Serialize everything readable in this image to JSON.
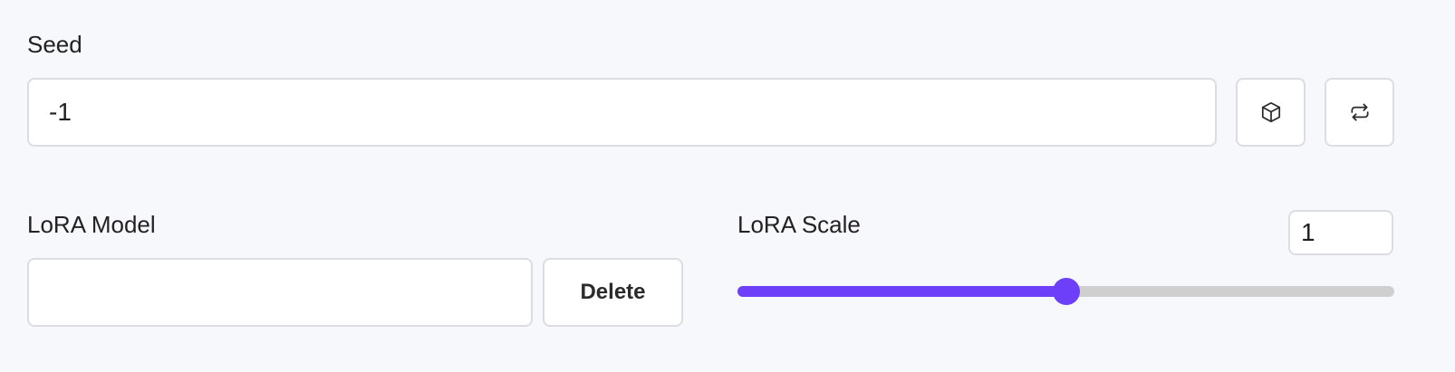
{
  "seed": {
    "label": "Seed",
    "value": "-1",
    "random_button_icon": "cube-icon",
    "reuse_button_icon": "repeat-icon"
  },
  "lora": {
    "model_label": "LoRA Model",
    "model_value": "",
    "delete_label": "Delete",
    "scale_label": "LoRA Scale",
    "scale_value": "1",
    "scale_slider_fraction": 0.5
  },
  "colors": {
    "accent": "#6e3ff8",
    "track": "#cfcfcf",
    "background": "#f7f8fc",
    "border": "#dcdde3"
  }
}
